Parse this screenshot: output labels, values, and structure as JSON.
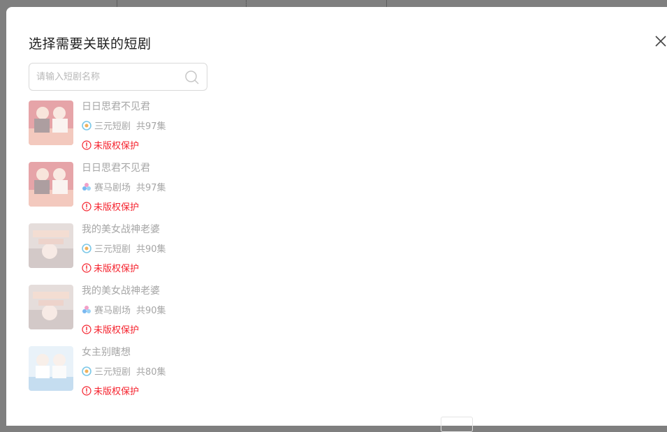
{
  "modal": {
    "title": "选择需要关联的短剧",
    "close_icon": "close-icon"
  },
  "search": {
    "placeholder": "请输入短剧名称",
    "value": "",
    "icon": "search-icon"
  },
  "colors": {
    "backdrop": "#7f7f7f",
    "warning": "#f5222d",
    "muted_text": "#a6a6a6"
  },
  "dramas": [
    {
      "title": "日日思君不见君",
      "platform": "三元短剧",
      "platform_icon": "sanyuan-logo-icon",
      "episodes": "共97集",
      "status": "未版权保护",
      "cover": "cover-ririsijun"
    },
    {
      "title": "日日思君不见君",
      "platform": "赛马剧场",
      "platform_icon": "saima-logo-icon",
      "episodes": "共97集",
      "status": "未版权保护",
      "cover": "cover-ririsijun"
    },
    {
      "title": "我的美女战神老婆",
      "platform": "三元短剧",
      "platform_icon": "sanyuan-logo-icon",
      "episodes": "共90集",
      "status": "未版权保护",
      "cover": "cover-zhanshen"
    },
    {
      "title": "我的美女战神老婆",
      "platform": "赛马剧场",
      "platform_icon": "saima-logo-icon",
      "episodes": "共90集",
      "status": "未版权保护",
      "cover": "cover-zhanshen"
    },
    {
      "title": "女主别瞎想",
      "platform": "三元短剧",
      "platform_icon": "sanyuan-logo-icon",
      "episodes": "共80集",
      "status": "未版权保护",
      "cover": "cover-nvzhu"
    }
  ]
}
